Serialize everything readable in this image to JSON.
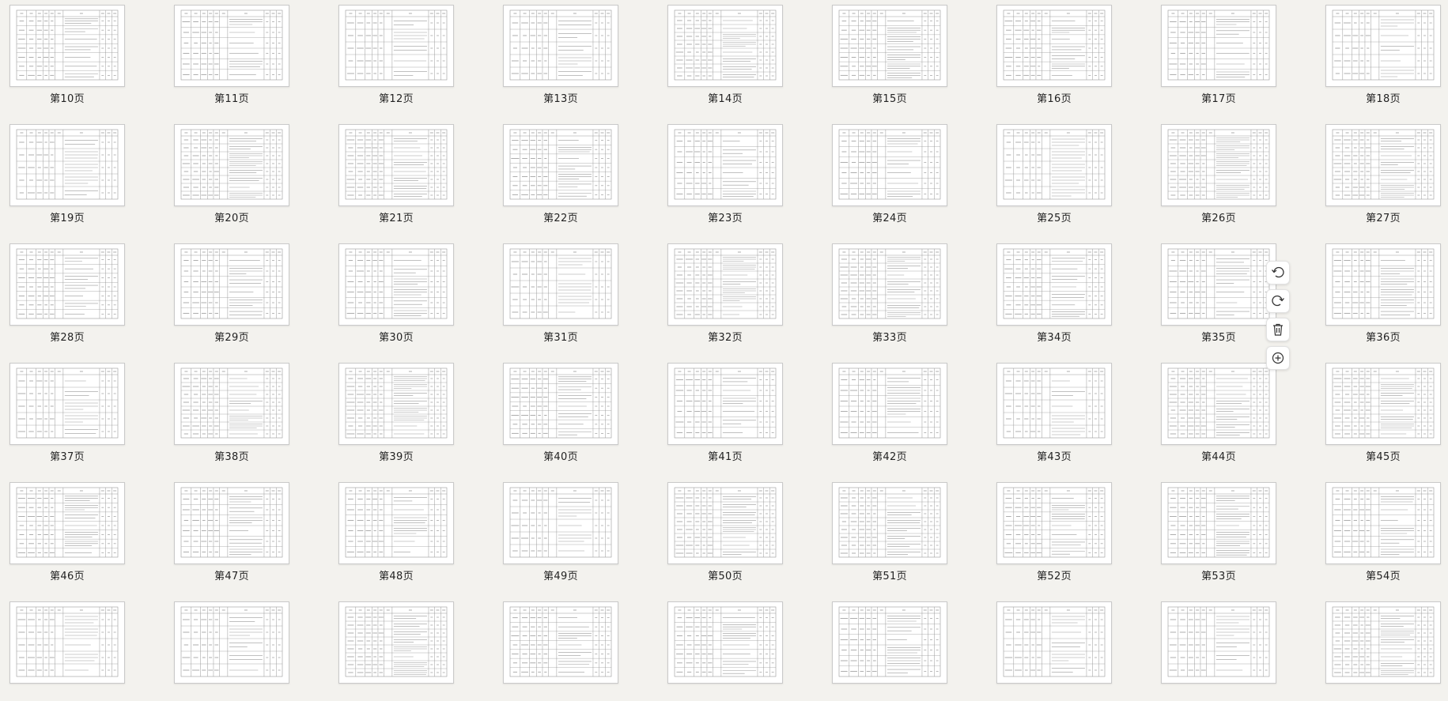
{
  "pages": [
    {
      "label": "第10页"
    },
    {
      "label": "第11页"
    },
    {
      "label": "第12页"
    },
    {
      "label": "第13页"
    },
    {
      "label": "第14页"
    },
    {
      "label": "第15页"
    },
    {
      "label": "第16页"
    },
    {
      "label": "第17页"
    },
    {
      "label": "第18页"
    },
    {
      "label": "第19页"
    },
    {
      "label": "第20页"
    },
    {
      "label": "第21页"
    },
    {
      "label": "第22页"
    },
    {
      "label": "第23页"
    },
    {
      "label": "第24页"
    },
    {
      "label": "第25页"
    },
    {
      "label": "第26页"
    },
    {
      "label": "第27页"
    },
    {
      "label": "第28页"
    },
    {
      "label": "第29页"
    },
    {
      "label": "第30页"
    },
    {
      "label": "第31页"
    },
    {
      "label": "第32页"
    },
    {
      "label": "第33页"
    },
    {
      "label": "第34页"
    },
    {
      "label": "第35页"
    },
    {
      "label": "第36页"
    },
    {
      "label": "第37页"
    },
    {
      "label": "第38页"
    },
    {
      "label": "第39页"
    },
    {
      "label": "第40页"
    },
    {
      "label": "第41页"
    },
    {
      "label": "第42页"
    },
    {
      "label": "第43页"
    },
    {
      "label": "第44页"
    },
    {
      "label": "第45页"
    },
    {
      "label": "第46页"
    },
    {
      "label": "第47页"
    },
    {
      "label": "第48页"
    },
    {
      "label": "第49页"
    },
    {
      "label": "第50页"
    },
    {
      "label": "第51页"
    },
    {
      "label": "第52页"
    },
    {
      "label": "第53页"
    },
    {
      "label": "第54页"
    },
    {
      "label": ""
    },
    {
      "label": ""
    },
    {
      "label": ""
    },
    {
      "label": ""
    },
    {
      "label": ""
    },
    {
      "label": ""
    },
    {
      "label": ""
    },
    {
      "label": ""
    },
    {
      "label": ""
    }
  ],
  "hover_toolbar": {
    "page_index": 25,
    "buttons": [
      {
        "name": "rotate-left-button",
        "icon": "rotate-left-icon"
      },
      {
        "name": "rotate-right-button",
        "icon": "rotate-right-icon"
      },
      {
        "name": "delete-page-button",
        "icon": "trash-icon"
      },
      {
        "name": "insert-page-button",
        "icon": "plus-circle-icon"
      }
    ]
  },
  "colors": {
    "background": "#f3f2ee",
    "thumb_border": "#c9c9c9",
    "table_line": "#9a9a9a",
    "text": "#222222"
  }
}
